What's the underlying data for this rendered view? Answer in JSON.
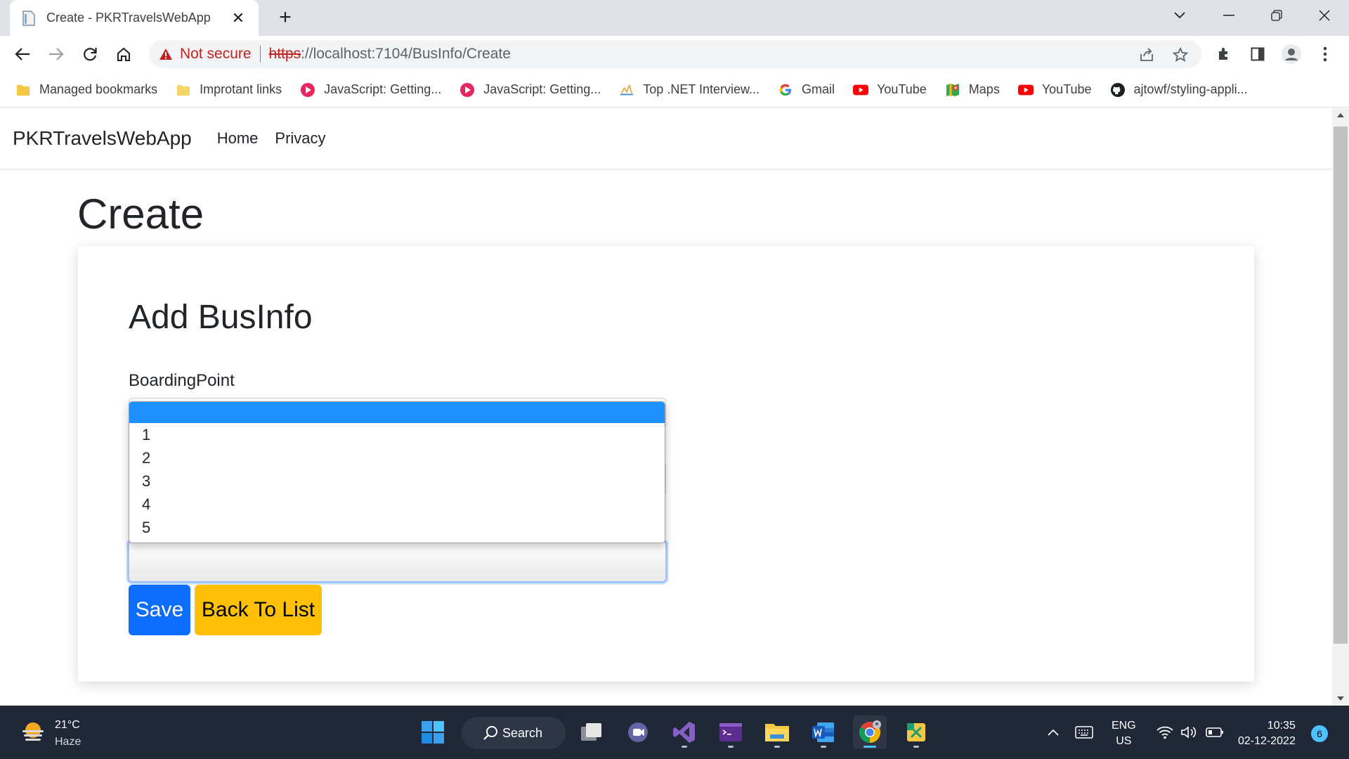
{
  "browser": {
    "tab_title": "Create - PKRTravelsWebApp",
    "security_label": "Not secure",
    "url_scheme": "https",
    "url_rest": "://localhost:7104/BusInfo/Create",
    "bookmarks": [
      {
        "label": "Managed bookmarks",
        "icon": "folder-icon"
      },
      {
        "label": "Improtant links",
        "icon": "folder-icon"
      },
      {
        "label": "JavaScript: Getting...",
        "icon": "play-icon"
      },
      {
        "label": "JavaScript: Getting...",
        "icon": "play-icon"
      },
      {
        "label": "Top .NET Interview...",
        "icon": "site-icon"
      },
      {
        "label": "Gmail",
        "icon": "google-icon"
      },
      {
        "label": "YouTube",
        "icon": "youtube-icon"
      },
      {
        "label": "Maps",
        "icon": "maps-icon"
      },
      {
        "label": "YouTube",
        "icon": "youtube-icon"
      },
      {
        "label": "ajtowf/styling-appli...",
        "icon": "github-icon"
      }
    ]
  },
  "site": {
    "brand": "PKRTravelsWebApp",
    "nav": [
      "Home",
      "Privacy"
    ]
  },
  "page": {
    "heading": "Create",
    "card_title": "Add BusInfo",
    "field_label": "BoardingPoint",
    "save_label": "Save",
    "back_label": "Back To List"
  },
  "dropdown": {
    "options": [
      "",
      "1",
      "2",
      "3",
      "4",
      "5"
    ],
    "selected_index": 0
  },
  "taskbar": {
    "temperature": "21°C",
    "condition": "Haze",
    "search_label": "Search",
    "lang_top": "ENG",
    "lang_bottom": "US",
    "time": "10:35",
    "date": "02-12-2022",
    "notification_count": "6"
  },
  "colors": {
    "primary": "#0d6efd",
    "warning": "#ffc107",
    "dropdown_highlight": "#1e90ff",
    "not_secure": "#c5221f"
  }
}
